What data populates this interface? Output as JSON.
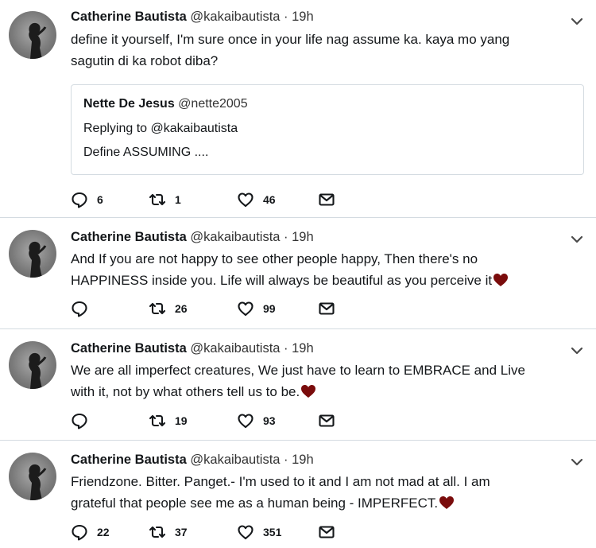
{
  "tweets": [
    {
      "name": "Catherine Bautista",
      "handle": "@kakaibautista",
      "time": "· 19h",
      "lines": [
        "define it yourself, I'm sure once in your life nag assume ka. kaya mo yang",
        "sagutin di ka robot diba?"
      ],
      "heart": false,
      "quote": {
        "name": "Nette De Jesus",
        "handle": "@nette2005",
        "replying": "Replying to @kakaibautista",
        "text": "Define ASSUMING ...."
      },
      "replies": "6",
      "retweets": "1",
      "likes": "46"
    },
    {
      "name": "Catherine Bautista",
      "handle": "@kakaibautista",
      "time": "· 19h",
      "lines": [
        "And If you are not happy to see other people happy, Then there's no",
        "HAPPINESS inside you. Life will always be beautiful as you perceive it"
      ],
      "heart": true,
      "replies": "",
      "retweets": "26",
      "likes": "99"
    },
    {
      "name": "Catherine Bautista",
      "handle": "@kakaibautista",
      "time": "· 19h",
      "lines": [
        "We are all imperfect creatures, We just have to learn to EMBRACE and Live",
        "with it, not by what others tell us to be."
      ],
      "heart": true,
      "replies": "",
      "retweets": "19",
      "likes": "93"
    },
    {
      "name": "Catherine Bautista",
      "handle": "@kakaibautista",
      "time": "· 19h",
      "lines": [
        "Friendzone. Bitter. Panget.- I'm used to it and I am not mad at all. I am",
        "grateful that people see me as a human being - IMPERFECT."
      ],
      "heart": true,
      "replies": "22",
      "retweets": "37",
      "likes": "351"
    }
  ],
  "icons": {
    "reply": "speech-bubble-icon",
    "retweet": "retweet-arrows-icon",
    "like": "heart-outline-icon",
    "dm": "envelope-icon",
    "caret": "chevron-down-icon",
    "emoji": "dark-red-heart-emoji"
  },
  "colors": {
    "icon": "#14171a",
    "divider": "#d4dbe1",
    "heart_emoji": "#7a0c0c"
  }
}
